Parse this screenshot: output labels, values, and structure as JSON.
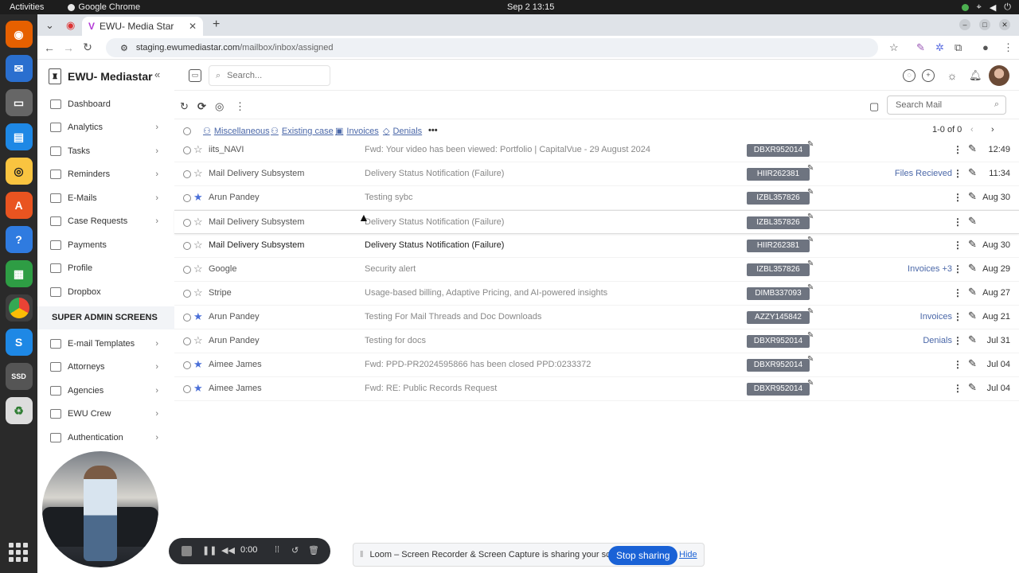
{
  "os": {
    "activities": "Activities",
    "app": "Google Chrome",
    "clock": "Sep 2  13:15"
  },
  "browser": {
    "tab_title": "EWU- Media Star",
    "url_host": "staging.ewumediastar.com",
    "url_path": "/mailbox/inbox/assigned"
  },
  "sidebar": {
    "brand": "EWU- Mediastar",
    "items": [
      {
        "label": "Dashboard",
        "chev": false
      },
      {
        "label": "Analytics",
        "chev": true
      },
      {
        "label": "Tasks",
        "chev": true
      },
      {
        "label": "Reminders",
        "chev": true
      },
      {
        "label": "E-Mails",
        "chev": true
      },
      {
        "label": "Case Requests",
        "chev": true
      },
      {
        "label": "Payments",
        "chev": false
      },
      {
        "label": "Profile",
        "chev": false
      },
      {
        "label": "Dropbox",
        "chev": false
      }
    ],
    "section": "SUPER ADMIN SCREENS",
    "admin_items": [
      {
        "label": "E-mail Templates"
      },
      {
        "label": "Attorneys"
      },
      {
        "label": "Agencies"
      },
      {
        "label": "EWU Crew"
      },
      {
        "label": "Authentication"
      }
    ]
  },
  "header": {
    "search_placeholder": "Search..."
  },
  "toolbar": {
    "search_mail_placeholder": "Search Mail"
  },
  "filters": {
    "items": [
      "Miscellaneous",
      "Existing case",
      "Invoices",
      "Denials"
    ],
    "pager": "1-0 of 0"
  },
  "mail_rows": [
    {
      "sender": "iits_NAVI",
      "subject": "Fwd: Your video has been viewed: Portfolio | CapitalVue - 29 August 2024",
      "code": "DBXR952014",
      "label": "",
      "date": "12:49",
      "starred": false,
      "unread": false
    },
    {
      "sender": "Mail Delivery Subsystem",
      "subject": "Delivery Status Notification (Failure)",
      "code": "HIIR262381",
      "label": "Files Recieved",
      "date": "11:34",
      "starred": false,
      "unread": false
    },
    {
      "sender": "Arun Pandey",
      "subject": "Testing sybc",
      "code": "IZBL357826",
      "label": "",
      "date": "Aug 30",
      "starred": true,
      "unread": false
    },
    {
      "sender": "Mail Delivery Subsystem",
      "subject": "Delivery Status Notification (Failure)",
      "code": "IZBL357826",
      "label": "",
      "date": "",
      "starred": false,
      "unread": false
    },
    {
      "sender": "Mail Delivery Subsystem",
      "subject": "Delivery Status Notification (Failure)",
      "code": "HIIR262381",
      "label": "",
      "date": "Aug 30",
      "starred": false,
      "unread": true
    },
    {
      "sender": "Google",
      "subject": "Security alert",
      "code": "IZBL357826",
      "label": "Invoices +3",
      "date": "Aug 29",
      "starred": false,
      "unread": false
    },
    {
      "sender": "Stripe",
      "subject": "Usage-based billing, Adaptive Pricing, and AI-powered insights",
      "code": "DIMB337093",
      "label": "",
      "date": "Aug 27",
      "starred": false,
      "unread": false
    },
    {
      "sender": "Arun Pandey",
      "subject": "Testing For Mail Threads and Doc Downloads",
      "code": "AZZY145842",
      "label": "Invoices",
      "date": "Aug 21",
      "starred": true,
      "unread": false
    },
    {
      "sender": "Arun Pandey",
      "subject": "Testing for docs",
      "code": "DBXR952014",
      "label": "Denials",
      "date": "Jul 31",
      "starred": false,
      "unread": false
    },
    {
      "sender": "Aimee James",
      "subject": "Fwd: PPD-PR2024595866  has been closed PPD:0233372",
      "code": "DBXR952014",
      "label": "",
      "date": "Jul 04",
      "starred": true,
      "unread": false
    },
    {
      "sender": "Aimee James",
      "subject": "Fwd: RE: Public Records Request",
      "code": "DBXR952014",
      "label": "",
      "date": "Jul 04",
      "starred": true,
      "unread": false
    }
  ],
  "loom": {
    "timer": "0:00",
    "share_text": "Loom – Screen Recorder & Screen Capture is sharing your screen.",
    "stop_label": "Stop sharing",
    "hide_label": "Hide"
  }
}
